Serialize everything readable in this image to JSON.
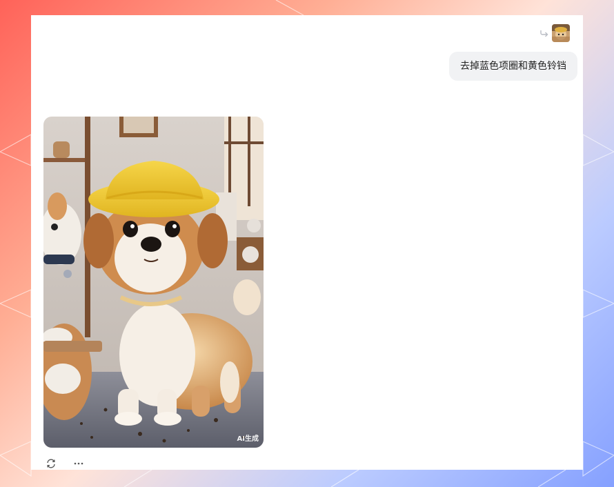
{
  "chat": {
    "user_message": "去掉蓝色项圈和黄色铃铛",
    "user_avatar": "user-avatar-image",
    "share_icon": "share-arrow-icon"
  },
  "result": {
    "image_description_icon": "dog-in-yellow-hat-image",
    "watermark": "AI生成"
  },
  "actions": {
    "regenerate_icon": "refresh-icon",
    "more_icon": "more-dots-icon"
  },
  "colors": {
    "bubble_bg": "#f1f2f4",
    "panel_bg": "#ffffff"
  }
}
